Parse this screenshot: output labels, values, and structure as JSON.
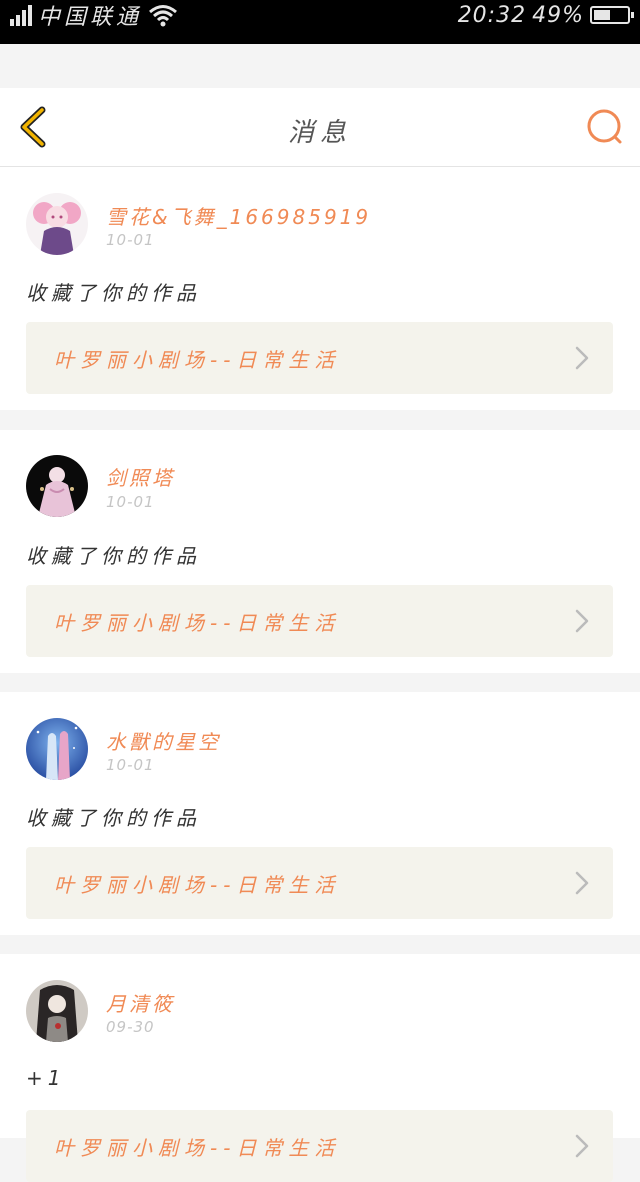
{
  "status_bar": {
    "carrier": "中国联通",
    "time": "20:32",
    "battery": "49%",
    "battery_level": 0.49
  },
  "header": {
    "title": "消息",
    "back_icon": "chevron-left-icon",
    "search_icon": "search-icon"
  },
  "colors": {
    "accent": "#f08a55",
    "back_arrow": "#f2b400",
    "link_bg": "#f4f3ec"
  },
  "messages": [
    {
      "username": "雪花&飞舞_166985919",
      "date": "10-01",
      "action": "收藏了你的作品",
      "work": "叶罗丽小剧场--日常生活"
    },
    {
      "username": "剑照塔",
      "date": "10-01",
      "action": "收藏了你的作品",
      "work": "叶罗丽小剧场--日常生活"
    },
    {
      "username": "水獸的星空",
      "date": "10-01",
      "action": "收藏了你的作品",
      "work": "叶罗丽小剧场--日常生活"
    },
    {
      "username": "月清筱",
      "date": "09-30",
      "action": "+1",
      "work": "叶罗丽小剧场--日常生活"
    }
  ]
}
